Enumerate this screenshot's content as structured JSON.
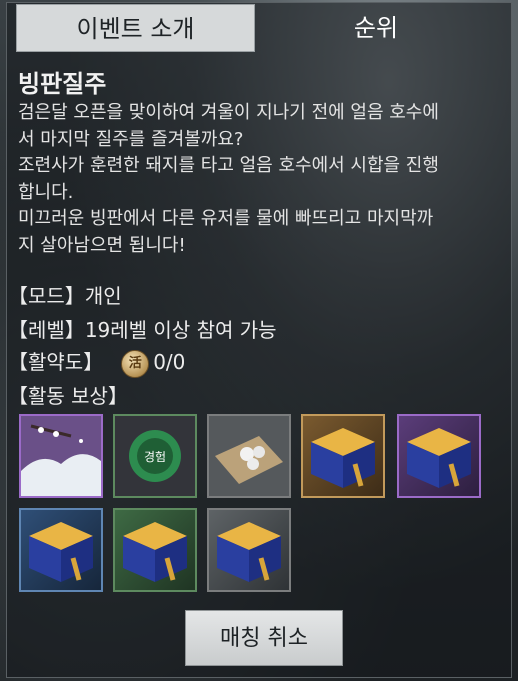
{
  "tabs": {
    "event_intro": "이벤트 소개",
    "ranking": "순위"
  },
  "event": {
    "title": "빙판질주",
    "description": "검은달 오픈을 맞이하여 겨울이 지나기 전에 얼음 호수에\n서 마지막 질주를 즐겨볼까요?\n조련사가 훈련한 돼지를 타고 얼음 호수에서 시합을 진행\n합니다.\n미끄러운 빙판에서 다른 유저를 물에 빠뜨리고 마지막까\n지 살아남으면 됩니다!"
  },
  "info": {
    "mode_label": "【모드】",
    "mode_value": "개인",
    "level_label": "【레벨】",
    "level_value": "19레벨 이상 참여 가능",
    "activity_label": "【활약도】",
    "activity_icon_char": "活",
    "activity_value": "0/0",
    "reward_label": "【활동 보상】"
  },
  "rewards": [
    {
      "icon": "snowy-landscape-icon",
      "grade": "purple"
    },
    {
      "icon": "experience-orb-icon",
      "grade": "green",
      "text": "경험"
    },
    {
      "icon": "pearls-on-cloth-icon",
      "grade": "gray"
    },
    {
      "icon": "treasure-box-icon",
      "grade": "gold"
    },
    {
      "icon": "treasure-box-icon",
      "grade": "purple"
    },
    {
      "icon": "treasure-box-icon",
      "grade": "blue"
    },
    {
      "icon": "treasure-box-icon",
      "grade": "green"
    },
    {
      "icon": "treasure-box-icon",
      "grade": "gray"
    }
  ],
  "buttons": {
    "cancel_matching": "매칭 취소"
  }
}
